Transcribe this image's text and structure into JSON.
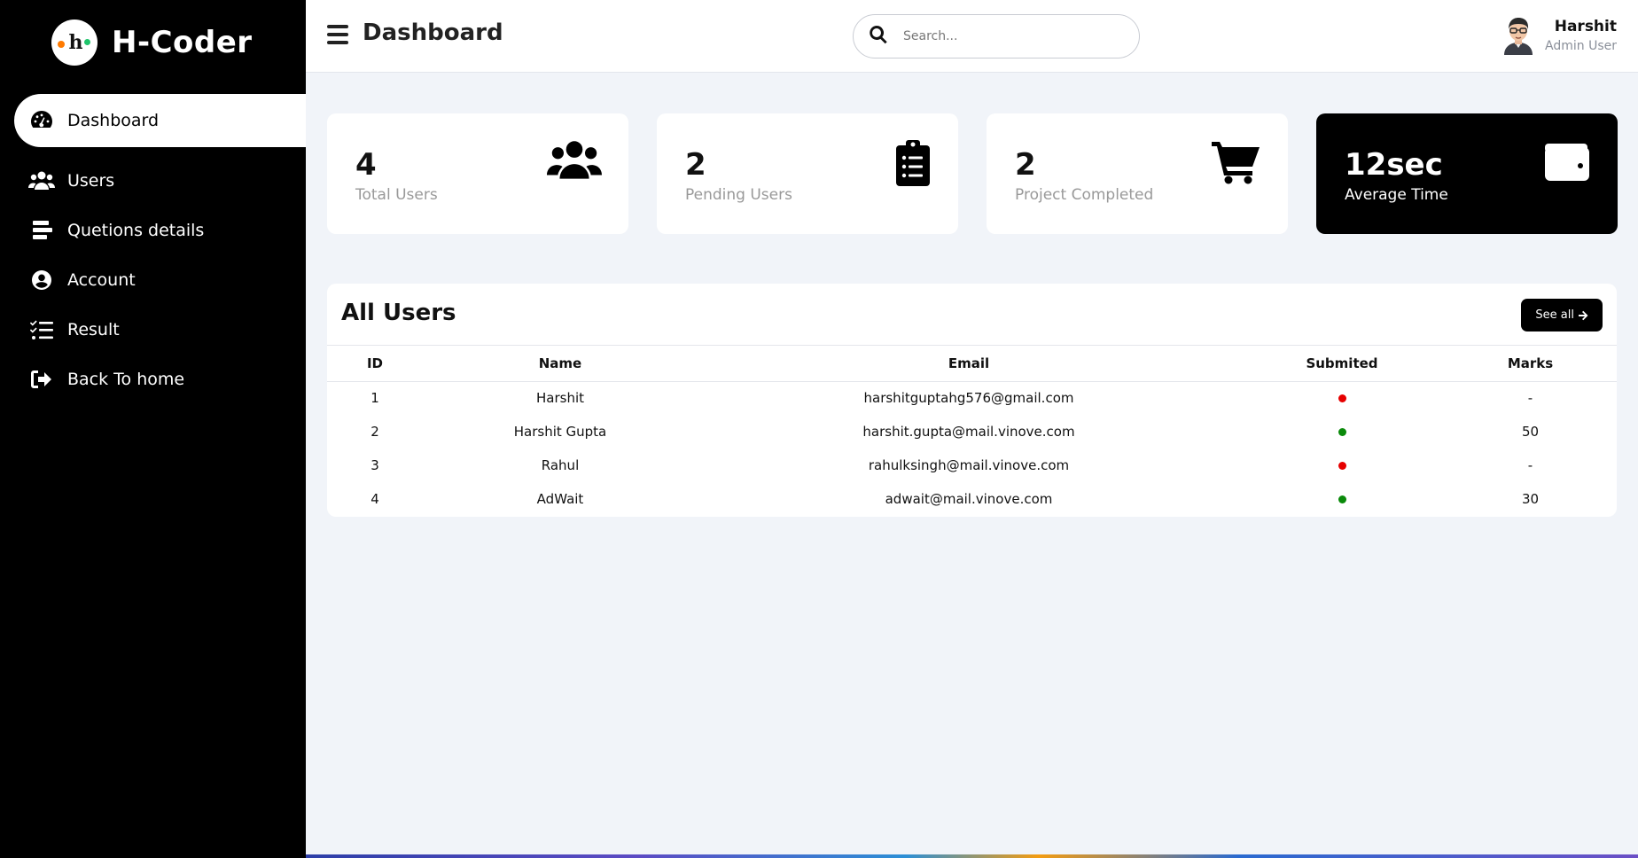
{
  "brand": {
    "name": "H-Coder",
    "logo_text": "h"
  },
  "sidebar": {
    "items": [
      {
        "label": "Dashboard",
        "icon": "speedometer-icon",
        "active": true
      },
      {
        "label": "Users",
        "icon": "users-icon"
      },
      {
        "label": "Quetions details",
        "icon": "stack-icon"
      },
      {
        "label": "Account",
        "icon": "user-circle-icon"
      },
      {
        "label": "Result",
        "icon": "checklist-icon"
      },
      {
        "label": "Back To home",
        "icon": "sign-out-icon"
      }
    ]
  },
  "header": {
    "title": "Dashboard",
    "search_placeholder": "Search...",
    "user_name": "Harshit",
    "user_role": "Admin User"
  },
  "cards": [
    {
      "value": "4",
      "label": "Total Users",
      "icon": "users-icon"
    },
    {
      "value": "2",
      "label": "Pending Users",
      "icon": "clipboard-list-icon"
    },
    {
      "value": "2",
      "label": "Project Completed",
      "icon": "cart-icon"
    },
    {
      "value": "12sec",
      "label": "Average Time",
      "icon": "wallet-icon"
    }
  ],
  "users_table": {
    "title": "All Users",
    "see_all": "See all",
    "columns": [
      "ID",
      "Name",
      "Email",
      "Submited",
      "Marks"
    ],
    "rows": [
      {
        "id": "1",
        "name": "Harshit",
        "email": "harshitguptahg576@gmail.com",
        "submitted": false,
        "marks": "-"
      },
      {
        "id": "2",
        "name": "Harshit Gupta",
        "email": "harshit.gupta@mail.vinove.com",
        "submitted": true,
        "marks": "50"
      },
      {
        "id": "3",
        "name": "Rahul",
        "email": "rahulksingh@mail.vinove.com",
        "submitted": false,
        "marks": "-"
      },
      {
        "id": "4",
        "name": "AdWait",
        "email": "adwait@mail.vinove.com",
        "submitted": true,
        "marks": "30"
      }
    ]
  },
  "colors": {
    "submitted_yes": "#0a8a0a",
    "submitted_no": "#e60000",
    "sidebar_bg": "#000000",
    "page_bg": "#f1f4f9"
  }
}
